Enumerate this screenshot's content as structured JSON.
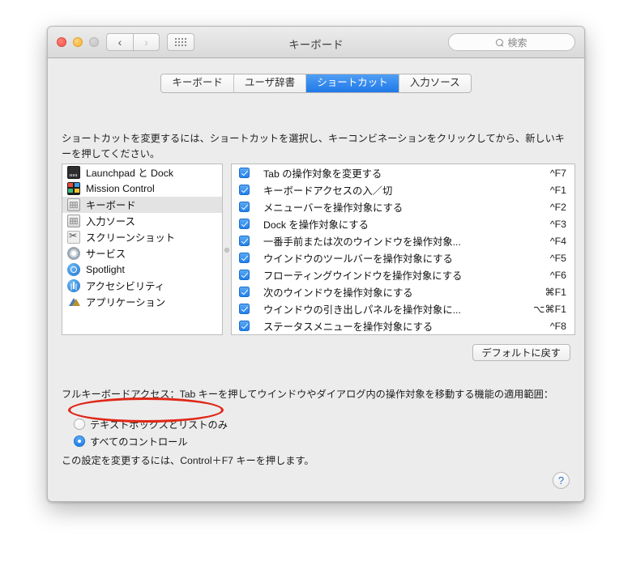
{
  "window": {
    "title": "キーボード",
    "traffic_lights": [
      "close",
      "minimize",
      "zoom-disabled"
    ],
    "nav_back": "‹",
    "nav_forward": "›",
    "grid_button": "grid-icon",
    "search_placeholder": "検索"
  },
  "tabs": [
    {
      "label": "キーボード",
      "active": false
    },
    {
      "label": "ユーザ辞書",
      "active": false
    },
    {
      "label": "ショートカット",
      "active": true
    },
    {
      "label": "入力ソース",
      "active": false
    }
  ],
  "description": "ショートカットを変更するには、ショートカットを選択し、キーコンビネーションをクリックしてから、新しいキーを押してください。",
  "sidebar": {
    "items": [
      {
        "label": "Launchpad と Dock",
        "icon": "launchpad-dock-icon",
        "selected": false
      },
      {
        "label": "Mission Control",
        "icon": "mission-control-icon",
        "selected": false
      },
      {
        "label": "キーボード",
        "icon": "keyboard-icon",
        "selected": true
      },
      {
        "label": "入力ソース",
        "icon": "input-source-icon",
        "selected": false
      },
      {
        "label": "スクリーンショット",
        "icon": "screenshot-icon",
        "selected": false
      },
      {
        "label": "サービス",
        "icon": "services-gear-icon",
        "selected": false
      },
      {
        "label": "Spotlight",
        "icon": "spotlight-icon",
        "selected": false
      },
      {
        "label": "アクセシビリティ",
        "icon": "accessibility-icon",
        "selected": false
      },
      {
        "label": "アプリケーション",
        "icon": "applications-icon",
        "selected": false
      }
    ]
  },
  "shortcuts": [
    {
      "checked": true,
      "label": "Tab の操作対象を変更する",
      "key": "^F7"
    },
    {
      "checked": true,
      "label": "キーボードアクセスの入／切",
      "key": "^F1"
    },
    {
      "checked": true,
      "label": "メニューバーを操作対象にする",
      "key": "^F2"
    },
    {
      "checked": true,
      "label": "Dock を操作対象にする",
      "key": "^F3"
    },
    {
      "checked": true,
      "label": "一番手前または次のウインドウを操作対象...",
      "key": "^F4"
    },
    {
      "checked": true,
      "label": "ウインドウのツールバーを操作対象にする",
      "key": "^F5"
    },
    {
      "checked": true,
      "label": "フローティングウインドウを操作対象にする",
      "key": "^F6"
    },
    {
      "checked": true,
      "label": "次のウインドウを操作対象にする",
      "key": "⌘F1"
    },
    {
      "checked": true,
      "label": "ウインドウの引き出しパネルを操作対象に...",
      "key": "⌥⌘F1"
    },
    {
      "checked": true,
      "label": "ステータスメニューを操作対象にする",
      "key": "^F8"
    }
  ],
  "defaults_button": "デフォルトに戻す",
  "full_keyboard_access": {
    "label": "フルキーボードアクセス：Tab キーを押してウインドウやダイアログ内の操作対象を移動する機能の適用範囲：",
    "options": [
      {
        "label": "テキストボックスとリストのみ",
        "selected": false
      },
      {
        "label": "すべてのコントロール",
        "selected": true
      }
    ],
    "hint": "この設定を変更するには、Control＋F7 キーを押します。"
  },
  "help_button": "?",
  "annotation": {
    "shape": "ellipse",
    "color": "#e02718",
    "target": "すべてのコントロール"
  }
}
